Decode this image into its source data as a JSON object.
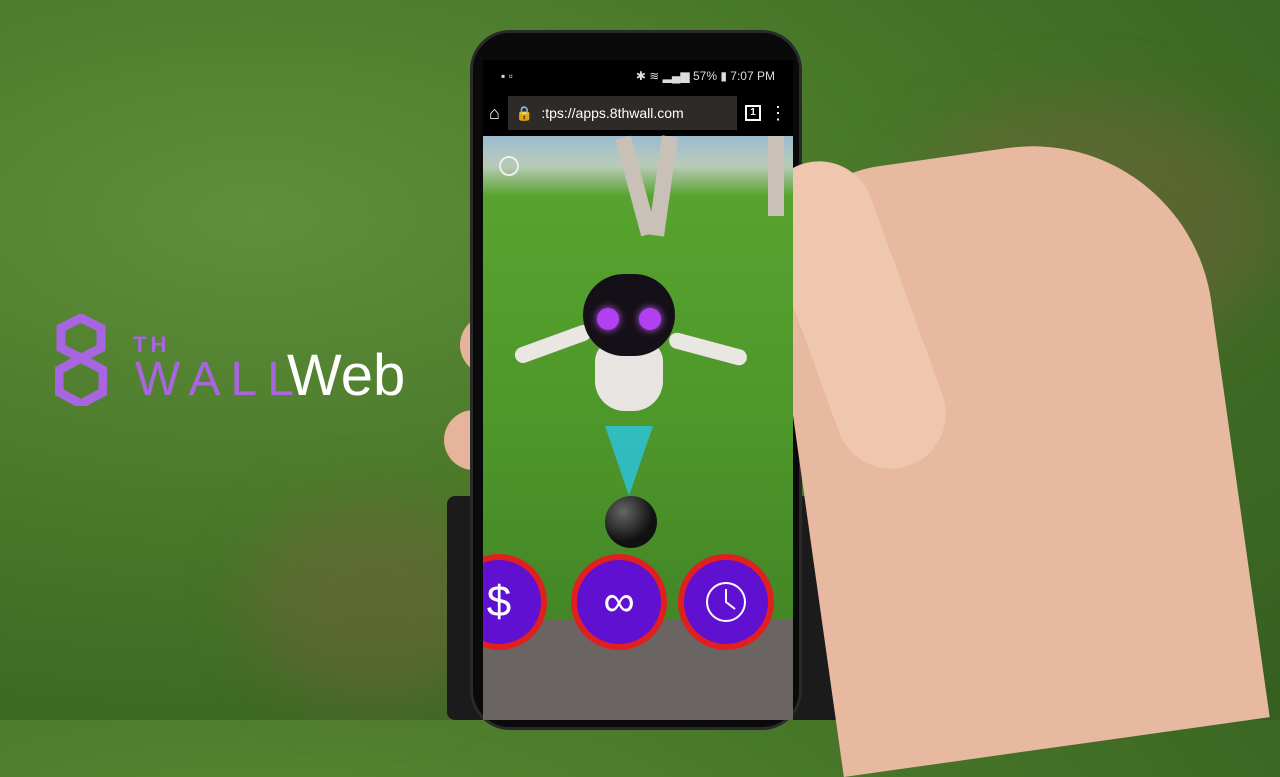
{
  "logo": {
    "eight": "8",
    "th": "TH",
    "wall": "WALL",
    "web": "Web",
    "color": "#a865e0"
  },
  "phone": {
    "status": {
      "battery": "57%",
      "time": "7:07 PM"
    },
    "browser": {
      "url": ":tps://apps.8thwall.com",
      "tab_count": "1"
    },
    "buttons": [
      {
        "icon": "dollar-icon",
        "glyph": "$"
      },
      {
        "icon": "infinity-icon",
        "glyph": "∞"
      },
      {
        "icon": "clock-icon",
        "glyph": "🕓"
      }
    ]
  }
}
